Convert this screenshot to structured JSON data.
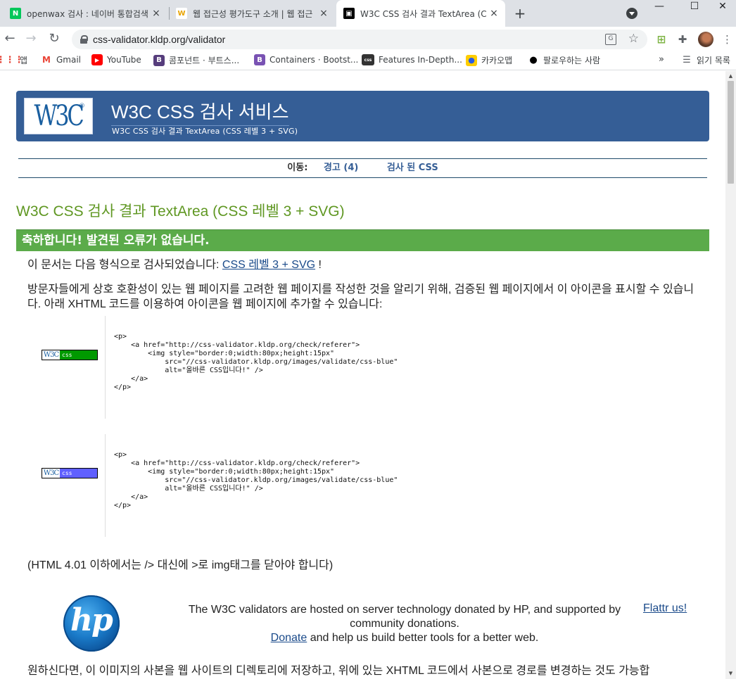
{
  "browser": {
    "tabs": [
      {
        "title": "openwax 검사 : 네이버 통합검색",
        "favicon": "N"
      },
      {
        "title": "웹 접근성 평가도구 소개 | 웹 접근",
        "favicon": "W"
      },
      {
        "title": "W3C CSS 검사 결과 TextArea (C",
        "favicon": "▣"
      }
    ],
    "url": "css-validator.kldp.org/validator",
    "bookmarks": [
      "앱",
      "Gmail",
      "YouTube",
      "콤포넌트 · 부트스...",
      "Containers · Bootst...",
      "Features In-Depth...",
      "카카오맵",
      "팔로우하는 사람"
    ],
    "reading_list": "읽기 목록",
    "more_bookmarks": "»"
  },
  "page": {
    "banner": {
      "title": "W3C CSS 검사 서비스",
      "subtitle": "W3C CSS 검사 결과 TextArea (CSS 레벨 3 + SVG)",
      "logo_text": "W3C",
      "logo_mark": "®"
    },
    "jump": {
      "label": "이동:",
      "warnings": "경고 (4)",
      "validated_css": "검사 된 CSS"
    },
    "result_title": "W3C CSS 검사 결과 TextArea (CSS 레벨 3 + SVG)",
    "congrats": "축하합니다! 발견된 오류가 없습니다.",
    "profile_prefix": "이 문서는 다음 형식으로 검사되었습니다: ",
    "profile_link": "CSS 레벨 3 + SVG",
    "profile_suffix": " !",
    "badge_info": "방문자들에게 상호 호환성이 있는 웹 페이지를 고려한 웹 페이지를 작성한 것을 알리기 위해, 검증된 웹 페이지에서 이 아이콘을 표시할 수 있습니다. 아래 XHTML 코드를 이용하여 아이콘을 웹 페이지에 추가할 수 있습니다:",
    "snippets": [
      {
        "badge_w3": "W3C",
        "badge_css": "css",
        "badge_color": "#009900",
        "code": "<p>\n    <a href=\"http://css-validator.kldp.org/check/referer\">\n        <img style=\"border:0;width:80px;height:15px\"\n            src=\"//css-validator.kldp.org/images/validate/css-blue\"\n            alt=\"올바른 CSS입니다!\" />\n    </a>\n</p>"
      },
      {
        "badge_w3": "W3C",
        "badge_css": "css",
        "badge_color": "#6060ff",
        "code": "<p>\n    <a href=\"http://css-validator.kldp.org/check/referer\">\n        <img style=\"border:0;width:80px;height:15px\"\n            src=\"//css-validator.kldp.org/images/validate/css-blue\"\n            alt=\"올바른 CSS입니다!\" />\n    </a>\n</p>"
      }
    ],
    "html401_note": "(HTML 4.01 이하에서는 /> 대신에 >로 img태그를 닫아야 합니다)",
    "sponsor": {
      "logo_text": "hp",
      "line1": "The W3C validators are hosted on server technology donated by HP, and supported by community donations.",
      "donate_link": "Donate",
      "line2": " and help us build better tools for a better web.",
      "flattr": "Flattr us!"
    },
    "bottom_text": "원하신다면, 이 이미지의 사본을 웹 사이트의 디렉토리에 저장하고, 위에 있는 XHTML 코드에서 사본으로 경로를 변경하는 것도 가능합"
  }
}
